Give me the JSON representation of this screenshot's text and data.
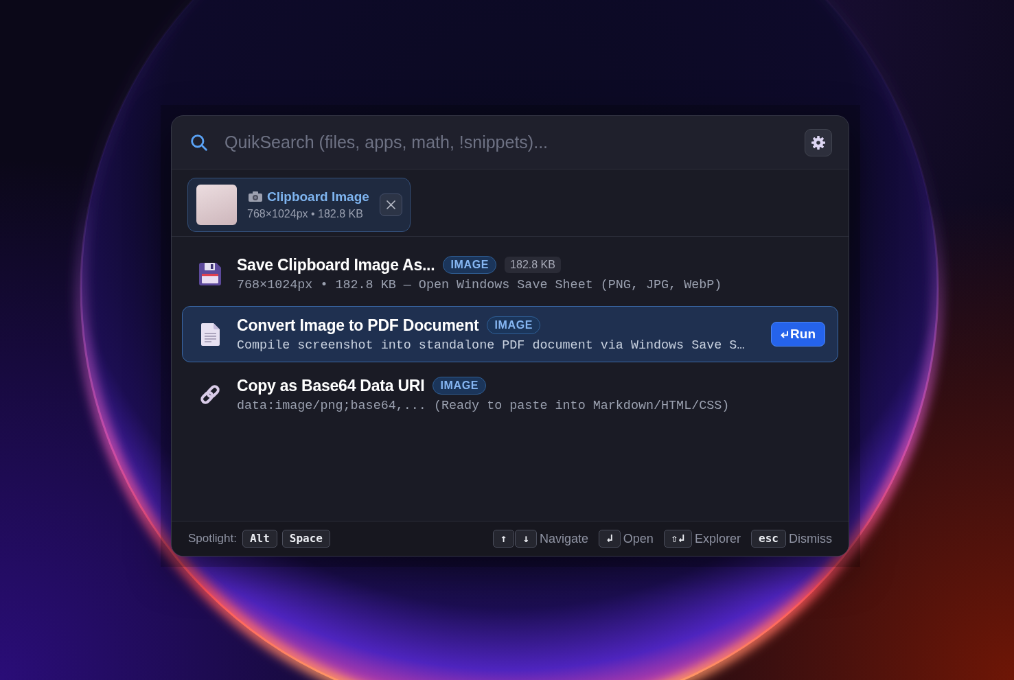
{
  "search": {
    "placeholder": "QuikSearch (files, apps, math, !snippets)..."
  },
  "attachment": {
    "title": "Clipboard Image",
    "details": "768×1024px • 182.8 KB"
  },
  "results": [
    {
      "kind": "save",
      "title": "Save Clipboard Image As...",
      "tag": "IMAGE",
      "size": "182.8 KB",
      "subtitle": "768×1024px • 182.8 KB — Open Windows Save Sheet (PNG, JPG, WebP)",
      "selected": false
    },
    {
      "kind": "document",
      "title": "Convert Image to PDF Document",
      "tag": "IMAGE",
      "subtitle": "Compile screenshot into standalone PDF document via Windows Save S…",
      "selected": true,
      "action": "Run"
    },
    {
      "kind": "link",
      "title": "Copy as Base64 Data URI",
      "tag": "IMAGE",
      "subtitle": "data:image/png;base64,... (Ready to paste into Markdown/HTML/CSS)",
      "selected": false
    }
  ],
  "footer": {
    "label": "Spotlight:",
    "hotkey": [
      "Alt",
      "Space"
    ],
    "hints": [
      {
        "keys": [
          "↑",
          "↓"
        ],
        "label": "Navigate"
      },
      {
        "keys": [
          "↲"
        ],
        "label": "Open"
      },
      {
        "keys": [
          "⇧↲"
        ],
        "label": "Explorer"
      },
      {
        "keys": [
          "esc"
        ],
        "label": "Dismiss"
      }
    ]
  }
}
